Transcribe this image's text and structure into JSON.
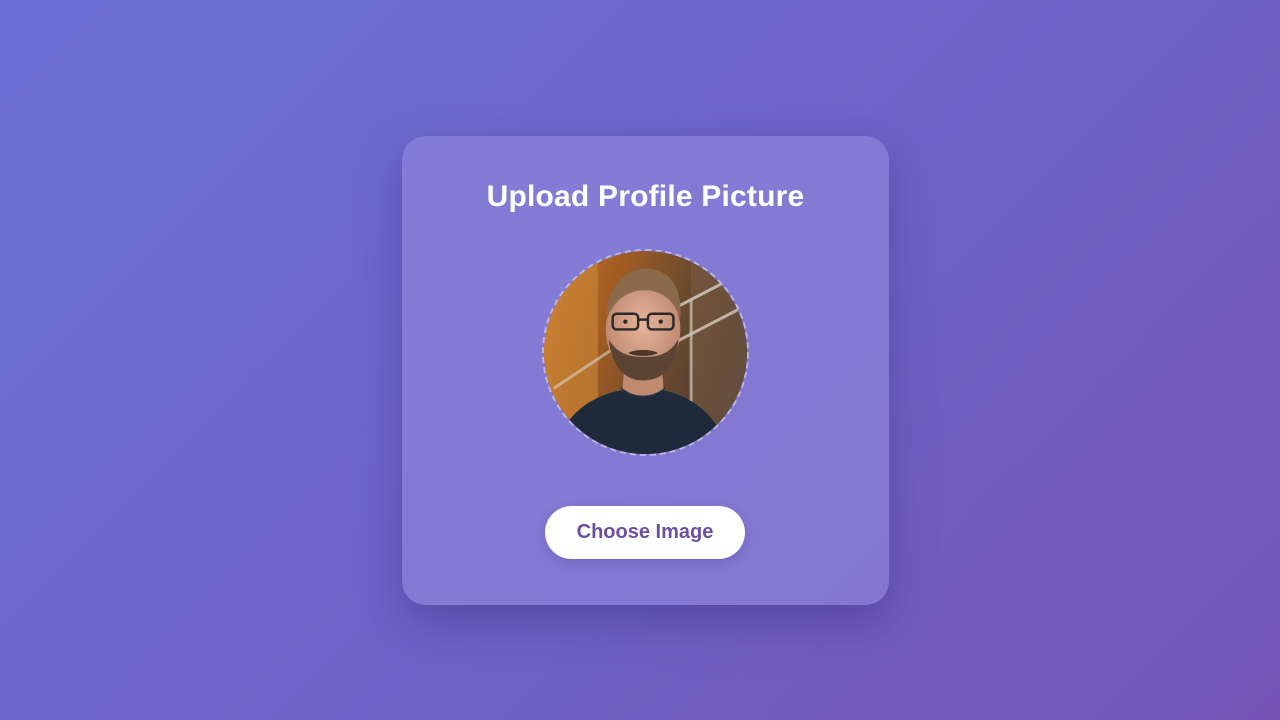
{
  "upload_card": {
    "title": "Upload Profile Picture",
    "choose_button_label": "Choose Image",
    "avatar_alt": "profile-photo-preview"
  },
  "colors": {
    "background_start": "#6c70d6",
    "background_end": "#7556b5",
    "button_text": "#6a4fa3",
    "title_text": "#ffffff"
  }
}
